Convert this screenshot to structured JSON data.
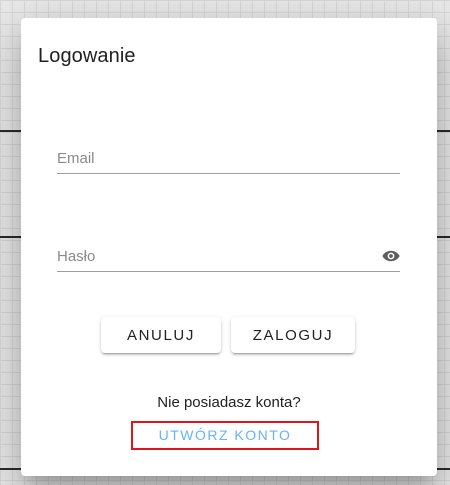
{
  "dialog": {
    "title": "Logowanie",
    "email_field": {
      "placeholder": "Email",
      "value": ""
    },
    "password_field": {
      "placeholder": "Hasło",
      "value": "",
      "toggle_icon": "eye-icon"
    },
    "cancel_label": "ANULUJ",
    "login_label": "ZALOGUJ",
    "no_account_text": "Nie posiadasz konta?",
    "create_account_label": "UTWÓRZ KONTO"
  },
  "colors": {
    "link": "#64b5f6",
    "highlight_border": "#e0141a"
  }
}
